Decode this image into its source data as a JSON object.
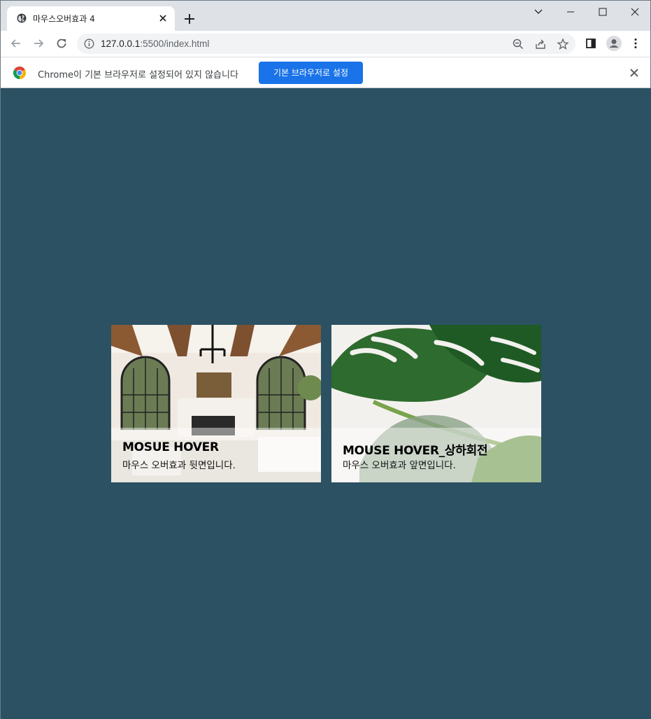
{
  "browser": {
    "tab_title": "마우스오버효과 4",
    "url_host": "127.0.0.1",
    "url_rest": ":5500/index.html",
    "icons": [
      "globe-icon",
      "close-icon",
      "plus-icon",
      "chevron-down-icon",
      "minimize-icon",
      "maximize-icon",
      "window-close-icon",
      "back-icon",
      "forward-icon",
      "reload-icon",
      "info-icon",
      "zoom-out-icon",
      "share-icon",
      "star-icon",
      "side-panel-icon",
      "profile-icon",
      "menu-icon",
      "chrome-logo-icon"
    ]
  },
  "infobar": {
    "message": "Chrome이 기본 브라우저로 설정되어 있지 않습니다",
    "button": "기본 브라우저로 설정"
  },
  "cards": [
    {
      "title": "MOSUE HOVER",
      "description": "마우스 오버효과 뒷면입니다.",
      "image": "living-room-photo"
    },
    {
      "title": "MOUSE HOVER_상하회전",
      "description": "마우스 오버효과 앞면입니다.",
      "image": "monstera-leaf-photo"
    }
  ],
  "colors": {
    "background": "#2b5163",
    "accent": "#1a73e8"
  }
}
